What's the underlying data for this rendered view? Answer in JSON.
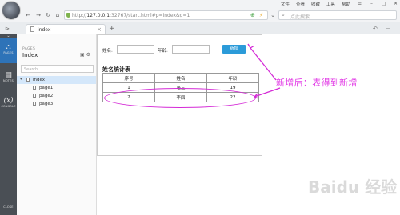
{
  "titlebar": {
    "menu": [
      "文件",
      "查看",
      "收藏",
      "工具",
      "帮助"
    ]
  },
  "addressbar": {
    "url_prefix": "http://",
    "url_host": "127.0.0.1",
    "url_rest": ":32767/start.html#p=index&g=1",
    "search_placeholder": "点此搜索"
  },
  "tabbar": {
    "tab_label": "index",
    "new_tab": "+"
  },
  "rail": {
    "items": [
      {
        "label": "PAGES",
        "icon": "sitemap-icon"
      },
      {
        "label": "NOTES",
        "icon": "notes-icon"
      },
      {
        "label": "CONSOLE",
        "icon": "console-icon"
      },
      {
        "label": "CLOSE",
        "icon": "close-icon"
      }
    ]
  },
  "panel": {
    "section": "PAGES",
    "title": "Index",
    "search_placeholder": "Search",
    "tree": [
      {
        "label": "index",
        "selected": true
      },
      {
        "label": "page1"
      },
      {
        "label": "page2"
      },
      {
        "label": "page3"
      }
    ]
  },
  "form": {
    "name_label": "姓名:",
    "age_label": "年龄:",
    "add_button": "新增"
  },
  "table": {
    "title": "姓名统计表",
    "headers": [
      "序号",
      "姓名",
      "年龄"
    ],
    "rows": [
      [
        "1",
        "张三",
        "19"
      ],
      [
        "2",
        "李四",
        "22"
      ]
    ]
  },
  "annotation": {
    "text": "新增后：表得到新增",
    "color": "#e23be6"
  },
  "watermark": "Baidu 经验"
}
